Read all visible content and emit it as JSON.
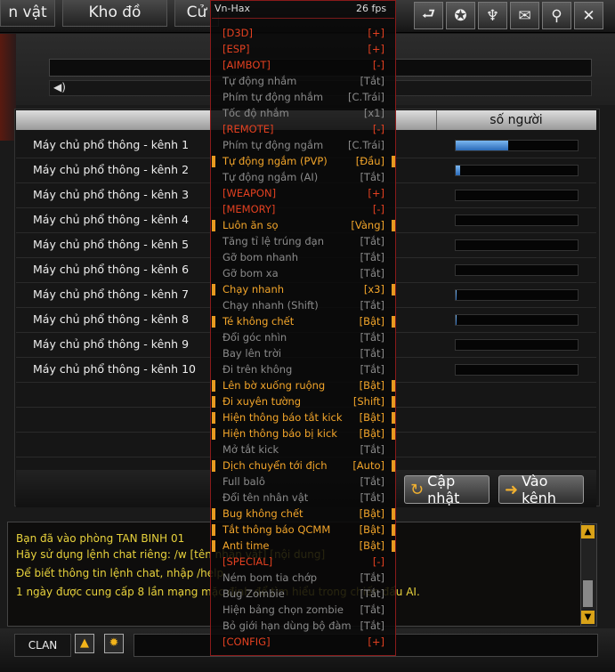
{
  "top_tabs": [
    "n vật",
    "Kho đồ",
    "Cử"
  ],
  "top_icons": [
    "back-icon",
    "star-badge-icon",
    "trophy-icon",
    "mail-icon",
    "wrench-icon",
    "close-icon"
  ],
  "top_icon_glyphs": [
    "⮐",
    "✪",
    "♆",
    "✉",
    "⚲",
    "✕"
  ],
  "table": {
    "count_header": "số người",
    "rows": [
      {
        "name": "Máy chủ phổ thông - kênh 1",
        "load": 0.43
      },
      {
        "name": "Máy chủ phổ thông - kênh 2",
        "load": 0.04
      },
      {
        "name": "Máy chủ phổ thông - kênh 3",
        "load": 0
      },
      {
        "name": "Máy chủ phổ thông - kênh 4",
        "load": 0
      },
      {
        "name": "Máy chủ phổ thông - kênh 5",
        "load": 0
      },
      {
        "name": "Máy chủ phổ thông - kênh 6",
        "load": 0
      },
      {
        "name": "Máy chủ phổ thông - kênh 7",
        "load": 0.01
      },
      {
        "name": "Máy chủ phổ thông - kênh 8",
        "load": 0.01
      },
      {
        "name": "Máy chủ phổ thông - kênh 9",
        "load": 0
      },
      {
        "name": "Máy chủ phổ thông - kênh 10",
        "load": 0
      }
    ]
  },
  "buttons": {
    "refresh": "Cập nhật",
    "enter": "Vào kênh"
  },
  "chat": {
    "lines": [
      "Bạn đã vào phòng TAN BINH 01",
      "Hãy sử dụng lệnh chat riêng: /w [tên nhân vật] [nội dung]",
      "Để biết thông tin lệnh chat, nhập /help",
      "1 ngày được cung cấp 8 lần mạng mặc định để tìm hiểu trong chiến đấu AI."
    ]
  },
  "bottom": {
    "clan_label": "CLAN"
  },
  "hack_menu": {
    "title": "Vn-Hax",
    "fps": "26 fps",
    "items": [
      {
        "label": "[D3D]",
        "value": "[+]",
        "kind": "hdr",
        "mark": false
      },
      {
        "label": "[ESP]",
        "value": "[+]",
        "kind": "hdr",
        "mark": false
      },
      {
        "label": "[AIMBOT]",
        "value": "[-]",
        "kind": "hdr",
        "mark": false
      },
      {
        "label": "Tự động nhắm",
        "value": "[Tắt]",
        "kind": "off",
        "mark": false
      },
      {
        "label": "Phím tự động nhắm",
        "value": "[C.Trái]",
        "kind": "off",
        "mark": false
      },
      {
        "label": "Tốc độ nhắm",
        "value": "[x1]",
        "kind": "off",
        "mark": false
      },
      {
        "label": "[REMOTE]",
        "value": "[-]",
        "kind": "hdr",
        "mark": false
      },
      {
        "label": "Phím tự động ngắm",
        "value": "[C.Trái]",
        "kind": "off",
        "mark": false
      },
      {
        "label": "Tự động ngắm (PVP)",
        "value": "[Đầu]",
        "kind": "on",
        "mark": true
      },
      {
        "label": "Tự động ngắm (AI)",
        "value": "[Tắt]",
        "kind": "off",
        "mark": false
      },
      {
        "label": "[WEAPON]",
        "value": "[+]",
        "kind": "hdr",
        "mark": false
      },
      {
        "label": "[MEMORY]",
        "value": "[-]",
        "kind": "hdr",
        "mark": false
      },
      {
        "label": "Luôn ăn sọ",
        "value": "[Vàng]",
        "kind": "on",
        "mark": true
      },
      {
        "label": "Tăng tỉ lệ trúng đạn",
        "value": "[Tắt]",
        "kind": "off",
        "mark": false
      },
      {
        "label": "Gỡ bom nhanh",
        "value": "[Tắt]",
        "kind": "off",
        "mark": false
      },
      {
        "label": "Gỡ bom xa",
        "value": "[Tắt]",
        "kind": "off",
        "mark": false
      },
      {
        "label": "Chạy nhanh",
        "value": "[x3]",
        "kind": "on",
        "mark": true
      },
      {
        "label": "Chạy nhanh (Shift)",
        "value": "[Tắt]",
        "kind": "off",
        "mark": false
      },
      {
        "label": "Té không chết",
        "value": "[Bật]",
        "kind": "on",
        "mark": true
      },
      {
        "label": "Đổi góc nhìn",
        "value": "[Tắt]",
        "kind": "off",
        "mark": false
      },
      {
        "label": "Bay lên trời",
        "value": "[Tắt]",
        "kind": "off",
        "mark": false
      },
      {
        "label": "Đi trên không",
        "value": "[Tắt]",
        "kind": "off",
        "mark": false
      },
      {
        "label": "Lên bờ xuống ruộng",
        "value": "[Bật]",
        "kind": "on",
        "mark": true
      },
      {
        "label": "Đi xuyên tường",
        "value": "[Shift]",
        "kind": "on",
        "mark": true
      },
      {
        "label": "Hiện thông báo tắt kick",
        "value": "[Bật]",
        "kind": "on",
        "mark": true
      },
      {
        "label": "Hiện thông báo bị kick",
        "value": "[Bật]",
        "kind": "on",
        "mark": true
      },
      {
        "label": "Mở tắt kick",
        "value": "[Tắt]",
        "kind": "off",
        "mark": false
      },
      {
        "label": "Dịch chuyển tới địch",
        "value": "[Auto]",
        "kind": "on",
        "mark": true
      },
      {
        "label": "Full balô",
        "value": "[Tắt]",
        "kind": "off",
        "mark": false
      },
      {
        "label": "Đổi tên nhân vật",
        "value": "[Tắt]",
        "kind": "off",
        "mark": false
      },
      {
        "label": "Bug không chết",
        "value": "[Bật]",
        "kind": "on",
        "mark": true
      },
      {
        "label": "Tắt thông báo QCMM",
        "value": "[Bật]",
        "kind": "on",
        "mark": true
      },
      {
        "label": "Anti time",
        "value": "[Bật]",
        "kind": "on",
        "mark": true
      },
      {
        "label": "[SPECIAL]",
        "value": "[-]",
        "kind": "hdr",
        "mark": false
      },
      {
        "label": "Ném bom tia chớp",
        "value": "[Tắt]",
        "kind": "off",
        "mark": false
      },
      {
        "label": "Bug Zombie",
        "value": "[Tắt]",
        "kind": "off",
        "mark": false
      },
      {
        "label": "Hiện bảng chọn zombie",
        "value": "[Tắt]",
        "kind": "off",
        "mark": false
      },
      {
        "label": "Bỏ giới hạn dùng bộ đàm",
        "value": "[Tắt]",
        "kind": "off",
        "mark": false
      },
      {
        "label": "[CONFIG]",
        "value": "[+]",
        "kind": "hdr",
        "mark": false
      }
    ]
  },
  "colors": {
    "accent_orange": "#f2a52a",
    "header_red": "#e24020",
    "chat_yellow": "#e8d23c",
    "bar_blue": "#2a6ab8"
  }
}
